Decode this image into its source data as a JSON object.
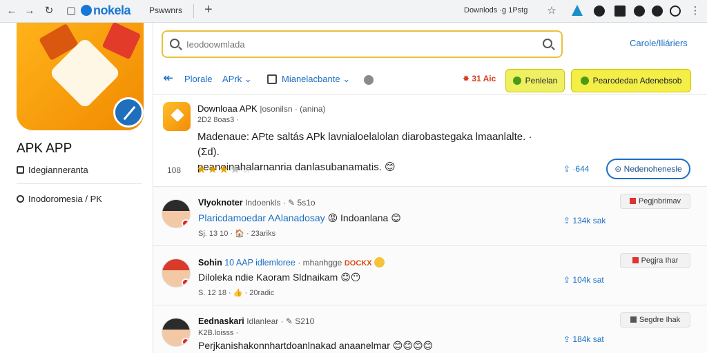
{
  "browser": {
    "logo_text": "nokela",
    "tab_title": "Pswwnrs",
    "address_right": "Downlods ·g 1Pstg"
  },
  "sidebar": {
    "app_title": "APK APP",
    "items": [
      {
        "label": "Idegianneranta",
        "icon": "square-icon"
      },
      {
        "label": "Inodoromesia / PK",
        "icon": "globe-icon"
      }
    ]
  },
  "search": {
    "placeholder": "Ieodoowmlada",
    "value": ""
  },
  "header": {
    "top_link": "Carole/Iliáriers"
  },
  "toolbar": {
    "tab_1": "Plorale",
    "tab_2": "APrk",
    "checkbox_label": "Mianelacbante",
    "points": "31 Aic",
    "button_1": "Penlelan",
    "button_2": "Pearodedan Adenebsob"
  },
  "featured": {
    "title": "Downloaa APK",
    "title_meta": "|osonilsn · (anina)",
    "date": "2D2 8oas3 ·",
    "body_line_1": "Madenaue: APte saltás APk lavnialoelalolan diarobastegaka lmaanlalte. · (Σd).",
    "body_line_2": "peanoinahalarnanria danlasubanamatis. 😊",
    "count": "108",
    "rating": 2.5,
    "rating_max": 5,
    "share_count": "·644",
    "action_button": "Nedenohenesle"
  },
  "comments": [
    {
      "author": "Vlyoknoter",
      "meta": "Indoenkls · ✎ 5s1o",
      "highlight": "",
      "tag": "",
      "body_blue": "Plaricdamoedar AAlanadosay",
      "body": "😡 Indoanlana 😊",
      "footer": "Sj. 13 10  ·  🏠 · 23ariks",
      "stat": "134k  sak",
      "reply_label": "Pegjnbrimav",
      "avatar_style": "plain"
    },
    {
      "author": "Sohin",
      "meta": "· mhanhgge",
      "highlight": "10 AAP idlemloree",
      "tag": "DOCKX",
      "body_blue": "",
      "body": "Diloleka ndie Kaoram Sldnaikam 😊😶",
      "footer": "S. 12 18  ·  👍 · 20radic",
      "stat": "104k  sat",
      "reply_label": "Pegjra Ihar",
      "avatar_style": "red"
    },
    {
      "author": "Eednaskari",
      "meta": "Idlanlear · ✎ S210",
      "highlight": "",
      "tag": "",
      "body_blue": "",
      "body": "Perjkanishakonnhartdoanlnakad anaanelmar 😊😊😊😊",
      "footer": "K2B.loisss ·",
      "stat": "184k  sat",
      "reply_label": "Segdre Ihak",
      "avatar_style": "plain"
    }
  ],
  "colors": {
    "accent": "#1a6fc4",
    "search_border": "#e8c23a",
    "button_yellow": "#eef061",
    "star": "#e0a200"
  }
}
